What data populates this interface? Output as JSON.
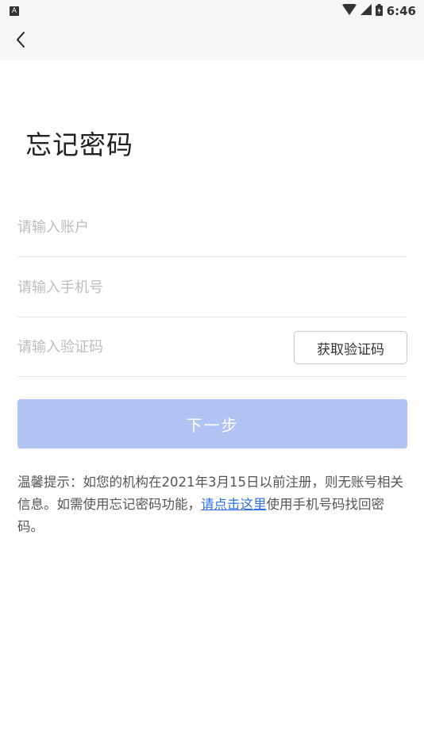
{
  "status_bar": {
    "notification_icon_label": "A",
    "time": "6:46",
    "icons": [
      "wifi-icon",
      "signal-icon",
      "battery-icon"
    ]
  },
  "toolbar": {
    "back_icon": "chevron-left-icon"
  },
  "page": {
    "title": "忘记密码"
  },
  "form": {
    "account_placeholder": "请输入账户",
    "account_value": "",
    "phone_placeholder": "请输入手机号",
    "phone_value": "",
    "code_placeholder": "请输入验证码",
    "code_value": "",
    "get_code_label": "获取验证码",
    "next_label": "下一步"
  },
  "tip": {
    "before_link": "温馨提示：如您的机构在2021年3月15日以前注册，则无账号相关信息。如需使用忘记密码功能，",
    "link_text": "请点击这里",
    "after_link": "使用手机号码找回密码。"
  },
  "colors": {
    "primary_button_disabled": "#b0c3f3",
    "link": "#2f6fe0",
    "placeholder": "#bdbdbd",
    "bar_background": "#f6f6f6"
  }
}
